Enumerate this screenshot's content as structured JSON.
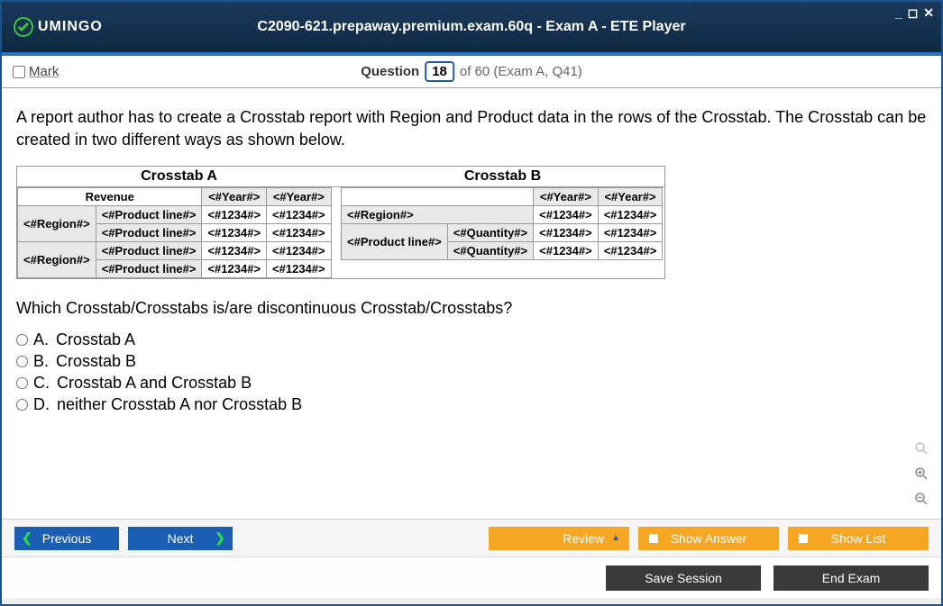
{
  "title": "C2090-621.prepaway.premium.exam.60q - Exam A - ETE Player",
  "logo_text": "UMINGO",
  "mark_label": "Mark",
  "question_label": "Question",
  "question_num": "18",
  "question_of": "of 60 (Exam A, Q41)",
  "question_stem_1": "A report author has to create a Crosstab report with Region and Product data in the rows of the Crosstab. The Crosstab can be created in two different ways as shown below.",
  "ctA": {
    "title": "Crosstab A",
    "corner": "Revenue",
    "cols": [
      "<#Year#>",
      "<#Year#>"
    ],
    "rows": [
      {
        "r": "<#Region#>",
        "p": "<#Product line#>",
        "v": [
          "<#1234#>",
          "<#1234#>"
        ]
      },
      {
        "r": "",
        "p": "<#Product line#>",
        "v": [
          "<#1234#>",
          "<#1234#>"
        ]
      },
      {
        "r": "<#Region#>",
        "p": "<#Product line#>",
        "v": [
          "<#1234#>",
          "<#1234#>"
        ]
      },
      {
        "r": "",
        "p": "<#Product line#>",
        "v": [
          "<#1234#>",
          "<#1234#>"
        ]
      }
    ]
  },
  "ctB": {
    "title": "Crosstab B",
    "cols": [
      "<#Year#>",
      "<#Year#>"
    ],
    "region": "<#Region#>",
    "rvals": [
      "<#1234#>",
      "<#1234#>"
    ],
    "pline": "<#Product line#>",
    "qrows": [
      {
        "q": "<#Quantity#>",
        "v": [
          "<#1234#>",
          "<#1234#>"
        ]
      },
      {
        "q": "<#Quantity#>",
        "v": [
          "<#1234#>",
          "<#1234#>"
        ]
      }
    ]
  },
  "sub_question": "Which Crosstab/Crosstabs is/are discontinuous Crosstab/Crosstabs?",
  "options": [
    {
      "letter": "A.",
      "text": "Crosstab A"
    },
    {
      "letter": "B.",
      "text": "Crosstab B"
    },
    {
      "letter": "C.",
      "text": "Crosstab A and Crosstab B"
    },
    {
      "letter": "D.",
      "text": "neither Crosstab A nor Crosstab B"
    }
  ],
  "buttons": {
    "previous": "Previous",
    "next": "Next",
    "review": "Review",
    "show_answer": "Show Answer",
    "show_list": "Show List",
    "save_session": "Save Session",
    "end_exam": "End Exam"
  }
}
